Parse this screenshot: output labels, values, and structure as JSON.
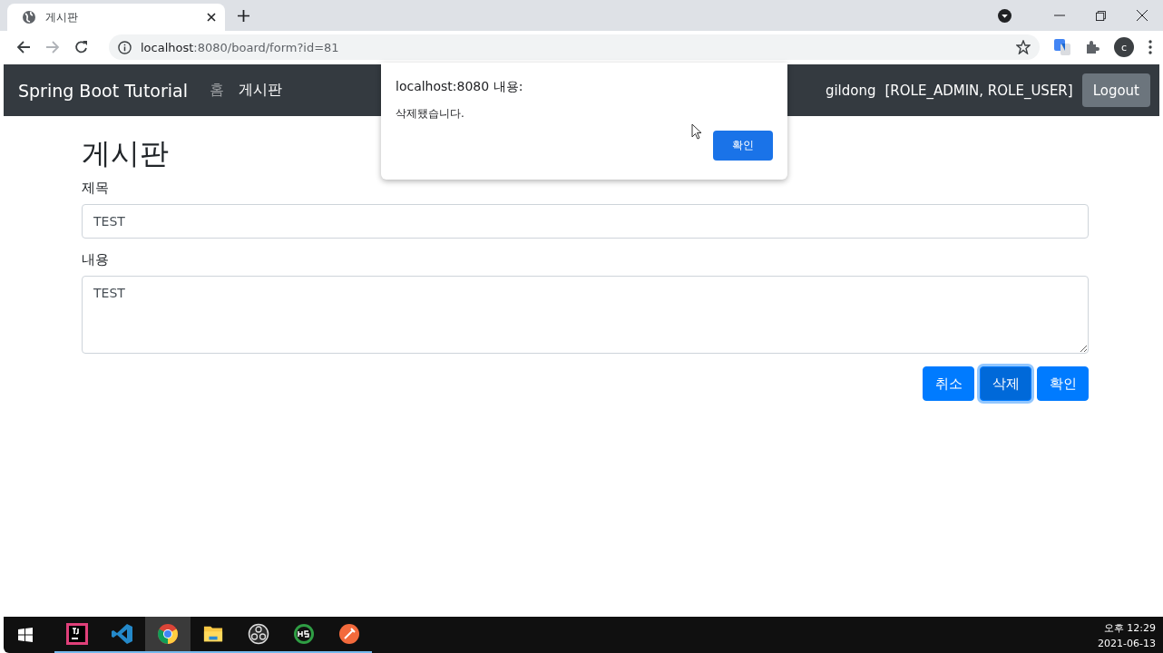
{
  "browser": {
    "tab": {
      "title": "게시판"
    },
    "url": {
      "host": "localhost",
      "rest": ":8080/board/form?id=81"
    },
    "profile_initial": "c"
  },
  "navbar": {
    "brand": "Spring Boot Tutorial",
    "links": [
      {
        "label": "홈",
        "selected": false
      },
      {
        "label": "게시판",
        "selected": true
      }
    ],
    "user": "gildong",
    "roles": "[ROLE_ADMIN, ROLE_USER]",
    "logout": "Logout"
  },
  "page": {
    "heading": "게시판",
    "fields": [
      {
        "kind": "input",
        "label": "제목",
        "value": "TEST"
      },
      {
        "kind": "textarea",
        "label": "내용",
        "value": "TEST"
      }
    ],
    "buttons": [
      {
        "label": "취소",
        "focused": false
      },
      {
        "label": "삭제",
        "focused": true
      },
      {
        "label": "확인",
        "focused": false
      }
    ]
  },
  "dialog": {
    "title": "localhost:8080 내용:",
    "message": "삭제됐습니다.",
    "button": "확인"
  },
  "taskbar": {
    "apps": [
      {
        "kind": "intellij",
        "selected": false
      },
      {
        "kind": "vscode",
        "selected": false
      },
      {
        "kind": "chrome",
        "selected": true
      },
      {
        "kind": "explorer",
        "selected": false
      },
      {
        "kind": "obs",
        "selected": false
      },
      {
        "kind": "hs",
        "selected": false
      },
      {
        "kind": "pen",
        "selected": false
      }
    ],
    "time": "오후 12:29",
    "date": "2021-06-13"
  }
}
